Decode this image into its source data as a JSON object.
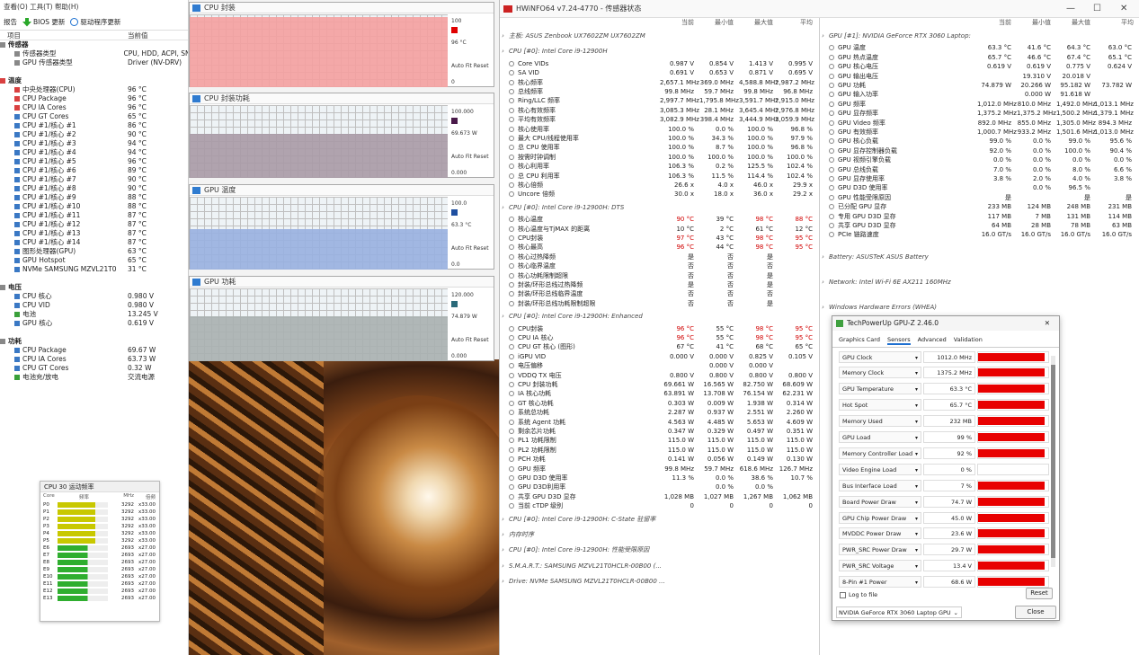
{
  "left": {
    "menu": "查看(O)    工具(T)    帮助(H)",
    "toolbar": {
      "report": "报告",
      "bios": "BIOS 更新",
      "driver": "驱动程序更新"
    },
    "col_item": "项目",
    "col_value": "当前值",
    "rows": [
      {
        "n": "传感器",
        "v": "",
        "cls": "sec",
        "ind": "",
        "icon": "v"
      },
      {
        "n": "传感器类型",
        "v": "CPU, HDD, ACPI, SN",
        "cls": "",
        "ind": "ind1",
        "icon": "v"
      },
      {
        "n": "GPU 传感器类型",
        "v": "Driver (NV-DRV)",
        "cls": "",
        "ind": "ind1",
        "icon": "v"
      },
      {
        "n": "",
        "v": "",
        "cls": "",
        "ind": "",
        "icon": ""
      },
      {
        "n": "温度",
        "v": "",
        "cls": "sec",
        "ind": "",
        "icon": "t"
      },
      {
        "n": "中央处理器(CPU)",
        "v": "96 °C",
        "cls": "",
        "ind": "ind1",
        "icon": "t"
      },
      {
        "n": "CPU Package",
        "v": "96 °C",
        "cls": "",
        "ind": "ind1",
        "icon": "t"
      },
      {
        "n": "CPU IA Cores",
        "v": "96 °C",
        "cls": "",
        "ind": "ind1",
        "icon": "t"
      },
      {
        "n": "CPU GT Cores",
        "v": "65 °C",
        "cls": "",
        "ind": "ind1",
        "icon": ""
      },
      {
        "n": "CPU #1/核心 #1",
        "v": "86 °C",
        "cls": "",
        "ind": "ind1",
        "icon": ""
      },
      {
        "n": "CPU #1/核心 #2",
        "v": "90 °C",
        "cls": "",
        "ind": "ind1",
        "icon": ""
      },
      {
        "n": "CPU #1/核心 #3",
        "v": "94 °C",
        "cls": "",
        "ind": "ind1",
        "icon": ""
      },
      {
        "n": "CPU #1/核心 #4",
        "v": "94 °C",
        "cls": "",
        "ind": "ind1",
        "icon": ""
      },
      {
        "n": "CPU #1/核心 #5",
        "v": "96 °C",
        "cls": "",
        "ind": "ind1",
        "icon": ""
      },
      {
        "n": "CPU #1/核心 #6",
        "v": "89 °C",
        "cls": "",
        "ind": "ind1",
        "icon": ""
      },
      {
        "n": "CPU #1/核心 #7",
        "v": "90 °C",
        "cls": "",
        "ind": "ind1",
        "icon": ""
      },
      {
        "n": "CPU #1/核心 #8",
        "v": "90 °C",
        "cls": "",
        "ind": "ind1",
        "icon": ""
      },
      {
        "n": "CPU #1/核心 #9",
        "v": "88 °C",
        "cls": "",
        "ind": "ind1",
        "icon": ""
      },
      {
        "n": "CPU #1/核心 #10",
        "v": "88 °C",
        "cls": "",
        "ind": "ind1",
        "icon": ""
      },
      {
        "n": "CPU #1/核心 #11",
        "v": "87 °C",
        "cls": "",
        "ind": "ind1",
        "icon": ""
      },
      {
        "n": "CPU #1/核心 #12",
        "v": "87 °C",
        "cls": "",
        "ind": "ind1",
        "icon": ""
      },
      {
        "n": "CPU #1/核心 #13",
        "v": "87 °C",
        "cls": "",
        "ind": "ind1",
        "icon": ""
      },
      {
        "n": "CPU #1/核心 #14",
        "v": "87 °C",
        "cls": "",
        "ind": "ind1",
        "icon": ""
      },
      {
        "n": "图形处理器(GPU)",
        "v": "63 °C",
        "cls": "",
        "ind": "ind1",
        "icon": ""
      },
      {
        "n": "GPU Hotspot",
        "v": "65 °C",
        "cls": "",
        "ind": "ind1",
        "icon": ""
      },
      {
        "n": "NVMe SAMSUNG MZVL21T0",
        "v": "31 °C",
        "cls": "",
        "ind": "ind1",
        "icon": ""
      },
      {
        "n": "",
        "v": "",
        "cls": "",
        "ind": "",
        "icon": ""
      },
      {
        "n": "电压",
        "v": "",
        "cls": "sec",
        "ind": "",
        "icon": "v"
      },
      {
        "n": "CPU 核心",
        "v": "0.980 V",
        "cls": "",
        "ind": "ind1",
        "icon": ""
      },
      {
        "n": "CPU VID",
        "v": "0.980 V",
        "cls": "",
        "ind": "ind1",
        "icon": ""
      },
      {
        "n": "电池",
        "v": "13.245 V",
        "cls": "",
        "ind": "ind1",
        "icon": "p"
      },
      {
        "n": "GPU 核心",
        "v": "0.619 V",
        "cls": "",
        "ind": "ind1",
        "icon": ""
      },
      {
        "n": "",
        "v": "",
        "cls": "",
        "ind": "",
        "icon": ""
      },
      {
        "n": "功耗",
        "v": "",
        "cls": "sec",
        "ind": "",
        "icon": "v"
      },
      {
        "n": "CPU Package",
        "v": "69.67 W",
        "cls": "",
        "ind": "ind1",
        "icon": ""
      },
      {
        "n": "CPU IA Cores",
        "v": "63.73 W",
        "cls": "",
        "ind": "ind1",
        "icon": ""
      },
      {
        "n": "CPU GT Cores",
        "v": "0.32 W",
        "cls": "",
        "ind": "ind1",
        "icon": ""
      },
      {
        "n": "电池充/放电",
        "v": "交流电源",
        "cls": "",
        "ind": "ind1",
        "icon": "p"
      }
    ]
  },
  "cpuz": {
    "title": "CPU 30  运动频率",
    "hdr": [
      "Core",
      "频率",
      "MHz",
      "倍频"
    ],
    "rows": [
      {
        "c": "P0",
        "mhz": "3292",
        "mul": "x33.00",
        "type": "p",
        "fill": 0.75
      },
      {
        "c": "P1",
        "mhz": "3292",
        "mul": "x33.00",
        "type": "p",
        "fill": 0.75
      },
      {
        "c": "P2",
        "mhz": "3292",
        "mul": "x33.00",
        "type": "p",
        "fill": 0.75
      },
      {
        "c": "P3",
        "mhz": "3292",
        "mul": "x33.00",
        "type": "p",
        "fill": 0.75
      },
      {
        "c": "P4",
        "mhz": "3292",
        "mul": "x33.00",
        "type": "p",
        "fill": 0.75
      },
      {
        "c": "P5",
        "mhz": "3292",
        "mul": "x33.00",
        "type": "p",
        "fill": 0.75
      },
      {
        "c": "E6",
        "mhz": "2693",
        "mul": "x27.00",
        "type": "e",
        "fill": 0.6
      },
      {
        "c": "E7",
        "mhz": "2693",
        "mul": "x27.00",
        "type": "e",
        "fill": 0.6
      },
      {
        "c": "E8",
        "mhz": "2693",
        "mul": "x27.00",
        "type": "e",
        "fill": 0.6
      },
      {
        "c": "E9",
        "mhz": "2693",
        "mul": "x27.00",
        "type": "e",
        "fill": 0.6
      },
      {
        "c": "E10",
        "mhz": "2693",
        "mul": "x27.00",
        "type": "e",
        "fill": 0.6
      },
      {
        "c": "E11",
        "mhz": "2693",
        "mul": "x27.00",
        "type": "e",
        "fill": 0.6
      },
      {
        "c": "E12",
        "mhz": "2693",
        "mul": "x27.00",
        "type": "e",
        "fill": 0.6
      },
      {
        "c": "E13",
        "mhz": "2693",
        "mul": "x27.00",
        "type": "e",
        "fill": 0.6
      }
    ]
  },
  "graphs": [
    {
      "title": "CPU 封装",
      "max": "100",
      "cur": "96 °C",
      "min": "0",
      "btn": "Auto Fit  Reset",
      "color": "#f4a0a0",
      "fill": 0.96,
      "sw": "#e00000"
    },
    {
      "title": "CPU 封装功耗",
      "max": "100.000",
      "cur": "69.673 W",
      "min": "0.000",
      "btn": "Auto Fit  Reset",
      "color": "#a89aa6",
      "fill": 0.6,
      "sw": "#4a1a4a"
    },
    {
      "title": "GPU 温度",
      "max": "100.0",
      "cur": "63.3 °C",
      "min": "0.0",
      "btn": "Auto Fit  Reset",
      "color": "#98b0e0",
      "fill": 0.55,
      "sw": "#1e4fa0"
    },
    {
      "title": "GPU 功耗",
      "max": "120.000",
      "cur": "74.879 W",
      "min": "0.000",
      "btn": "Auto Fit  Reset",
      "color": "#a8b0b0",
      "fill": 0.62,
      "sw": "#2a6a7a"
    }
  ],
  "hwinfo": {
    "title": "HWiNFO64 v7.24-4770 - 传感器状态",
    "cols": [
      "当前",
      "最小值",
      "最大值",
      "平均"
    ],
    "left_rows": [
      {
        "g": 1,
        "n": "主板: ASUS Zenbook UX7602ZM UX7602ZM"
      },
      {
        "g": 1,
        "n": "CPU [#0]: Intel Core i9-12900H"
      },
      {
        "n": "Core VIDs",
        "a": "0.987 V",
        "b": "0.854 V",
        "c": "1.413 V",
        "d": "0.995 V"
      },
      {
        "n": "SA VID",
        "a": "0.691 V",
        "b": "0.653 V",
        "c": "0.871 V",
        "d": "0.695 V"
      },
      {
        "n": "核心频率",
        "a": "2,657.1 MHz",
        "b": "369.0 MHz",
        "c": "4,588.8 MHz",
        "d": "2,987.2 MHz"
      },
      {
        "n": "总线频率",
        "a": "99.8 MHz",
        "b": "59.7 MHz",
        "c": "99.8 MHz",
        "d": "96.8 MHz"
      },
      {
        "n": "Ring/LLC 频率",
        "a": "2,997.7 MHz",
        "b": "1,795.8 MHz",
        "c": "3,591.7 MHz",
        "d": "2,915.0 MHz"
      },
      {
        "n": "核心有效频率",
        "a": "3,085.3 MHz",
        "b": "28.1 MHz",
        "c": "3,645.4 MHz",
        "d": "2,976.8 MHz"
      },
      {
        "n": "平均有效频率",
        "a": "3,082.9 MHz",
        "b": "398.4 MHz",
        "c": "3,444.9 MHz",
        "d": "3,059.9 MHz"
      },
      {
        "n": "核心使用率",
        "a": "100.0 %",
        "b": "0.0 %",
        "c": "100.0 %",
        "d": "96.8 %"
      },
      {
        "n": "最大 CPU/线程使用率",
        "a": "100.0 %",
        "b": "34.3 %",
        "c": "100.0 %",
        "d": "97.9 %"
      },
      {
        "n": "总 CPU 使用率",
        "a": "100.0 %",
        "b": "8.7 %",
        "c": "100.0 %",
        "d": "96.8 %"
      },
      {
        "n": "按需时钟调制",
        "a": "100.0 %",
        "b": "100.0 %",
        "c": "100.0 %",
        "d": "100.0 %"
      },
      {
        "n": "核心利用率",
        "a": "106.3 %",
        "b": "0.2 %",
        "c": "125.5 %",
        "d": "102.4 %"
      },
      {
        "n": "总 CPU 利用率",
        "a": "106.3 %",
        "b": "11.5 %",
        "c": "114.4 %",
        "d": "102.4 %"
      },
      {
        "n": "核心倍频",
        "a": "26.6 x",
        "b": "4.0 x",
        "c": "46.0 x",
        "d": "29.9 x"
      },
      {
        "n": "Uncore 倍频",
        "a": "30.0 x",
        "b": "18.0 x",
        "c": "36.0 x",
        "d": "29.2 x"
      },
      {
        "g": 1,
        "n": "CPU [#0]: Intel Core i9-12900H: DTS"
      },
      {
        "n": "核心温度",
        "a": "90 °C",
        "b": "39 °C",
        "c": "98 °C",
        "d": "88 °C",
        "red": 1
      },
      {
        "n": "核心温度与TjMAX 的距离",
        "a": "10 °C",
        "b": "2 °C",
        "c": "61 °C",
        "d": "12 °C"
      },
      {
        "n": "CPU封装",
        "a": "97 °C",
        "b": "43 °C",
        "c": "98 °C",
        "d": "95 °C",
        "red": 1
      },
      {
        "n": "核心最高",
        "a": "96 °C",
        "b": "44 °C",
        "c": "98 °C",
        "d": "95 °C",
        "red": 1
      },
      {
        "n": "核心过热降频",
        "a": "是",
        "b": "否",
        "c": "是",
        "d": ""
      },
      {
        "n": "核心临界温度",
        "a": "否",
        "b": "否",
        "c": "否",
        "d": ""
      },
      {
        "n": "核心功耗限制超限",
        "a": "否",
        "b": "否",
        "c": "是",
        "d": ""
      },
      {
        "n": "封装/环形总线过热降频",
        "a": "是",
        "b": "否",
        "c": "是",
        "d": ""
      },
      {
        "n": "封装/环形总线临界温度",
        "a": "否",
        "b": "否",
        "c": "否",
        "d": ""
      },
      {
        "n": "封装/环形总线功耗限制超限",
        "a": "否",
        "b": "否",
        "c": "是",
        "d": ""
      },
      {
        "g": 1,
        "n": "CPU [#0]: Intel Core i9-12900H: Enhanced"
      },
      {
        "n": "CPU封装",
        "a": "96 °C",
        "b": "55 °C",
        "c": "98 °C",
        "d": "95 °C",
        "red": 1
      },
      {
        "n": "CPU IA 核心",
        "a": "96 °C",
        "b": "55 °C",
        "c": "98 °C",
        "d": "95 °C",
        "red": 1
      },
      {
        "n": "CPU GT 核心 (图形)",
        "a": "67 °C",
        "b": "41 °C",
        "c": "68 °C",
        "d": "65 °C"
      },
      {
        "n": "iGPU VID",
        "a": "0.000 V",
        "b": "0.000 V",
        "c": "0.825 V",
        "d": "0.105 V"
      },
      {
        "n": "电压偏移",
        "a": "",
        "b": "0.000 V",
        "c": "0.000 V",
        "d": ""
      },
      {
        "n": "VDDQ TX 电压",
        "a": "0.800 V",
        "b": "0.800 V",
        "c": "0.800 V",
        "d": "0.800 V"
      },
      {
        "n": "CPU 封装功耗",
        "a": "69.661 W",
        "b": "16.565 W",
        "c": "82.750 W",
        "d": "68.609 W"
      },
      {
        "n": "IA 核心功耗",
        "a": "63.891 W",
        "b": "13.708 W",
        "c": "76.154 W",
        "d": "62.231 W"
      },
      {
        "n": "GT 核心功耗",
        "a": "0.303 W",
        "b": "0.009 W",
        "c": "1.938 W",
        "d": "0.314 W"
      },
      {
        "n": "系统总功耗",
        "a": "2.287 W",
        "b": "0.937 W",
        "c": "2.551 W",
        "d": "2.260 W"
      },
      {
        "n": "系统 Agent 功耗",
        "a": "4.563 W",
        "b": "4.485 W",
        "c": "5.653 W",
        "d": "4.609 W"
      },
      {
        "n": "剩余芯片功耗",
        "a": "0.347 W",
        "b": "0.329 W",
        "c": "0.497 W",
        "d": "0.351 W"
      },
      {
        "n": "PL1 功耗限制",
        "a": "115.0 W",
        "b": "115.0 W",
        "c": "115.0 W",
        "d": "115.0 W"
      },
      {
        "n": "PL2 功耗限制",
        "a": "115.0 W",
        "b": "115.0 W",
        "c": "115.0 W",
        "d": "115.0 W"
      },
      {
        "n": "PCH 功耗",
        "a": "0.141 W",
        "b": "0.056 W",
        "c": "0.149 W",
        "d": "0.130 W"
      },
      {
        "n": "GPU 频率",
        "a": "99.8 MHz",
        "b": "59.7 MHz",
        "c": "618.6 MHz",
        "d": "126.7 MHz"
      },
      {
        "n": "GPU D3D 使用率",
        "a": "11.3 %",
        "b": "0.0 %",
        "c": "38.6 %",
        "d": "10.7 %"
      },
      {
        "n": "GPU D3D利用率",
        "a": "",
        "b": "0.0 %",
        "c": "0.0 %",
        "d": ""
      },
      {
        "n": "共享 GPU D3D 显存",
        "a": "1,028 MB",
        "b": "1,027 MB",
        "c": "1,267 MB",
        "d": "1,062 MB"
      },
      {
        "n": "当前 cTDP 级别",
        "a": "0",
        "b": "0",
        "c": "0",
        "d": "0"
      },
      {
        "g": 1,
        "n": "CPU [#0]: Intel Core i9-12900H: C-State 驻留率"
      },
      {
        "g": 1,
        "n": "内存时序"
      },
      {
        "g": 1,
        "n": "CPU [#0]: Intel Core i9-12900H: 性能受限原因"
      },
      {
        "g": 1,
        "n": "S.M.A.R.T.: SAMSUNG MZVL21T0HCLR-00B00 (..."
      },
      {
        "g": 1,
        "n": "Drive: NVMe SAMSUNG MZVL21T0HCLR-00B00 ..."
      }
    ],
    "right_rows": [
      {
        "g": 1,
        "n": "GPU [#1]: NVIDIA GeForce RTX 3060 Laptop:"
      },
      {
        "n": "GPU 温度",
        "a": "63.3 °C",
        "b": "41.6 °C",
        "c": "64.3 °C",
        "d": "63.0 °C"
      },
      {
        "n": "GPU 热点温度",
        "a": "65.7 °C",
        "b": "46.6 °C",
        "c": "67.4 °C",
        "d": "65.1 °C"
      },
      {
        "n": "GPU 核心电压",
        "a": "0.619 V",
        "b": "0.619 V",
        "c": "0.775 V",
        "d": "0.624 V"
      },
      {
        "n": "GPU 输出电压",
        "a": "",
        "b": "19.310 V",
        "c": "20.018 V",
        "d": ""
      },
      {
        "n": "GPU 功耗",
        "a": "74.879 W",
        "b": "20.266 W",
        "c": "95.182 W",
        "d": "73.782 W"
      },
      {
        "n": "GPU 输入功率",
        "a": "",
        "b": "0.000 W",
        "c": "91.618 W",
        "d": ""
      },
      {
        "n": "GPU 频率",
        "a": "1,012.0 MHz",
        "b": "810.0 MHz",
        "c": "1,492.0 MHz",
        "d": "1,013.1 MHz"
      },
      {
        "n": "GPU 显存频率",
        "a": "1,375.2 MHz",
        "b": "1,375.2 MHz",
        "c": "1,500.2 MHz",
        "d": "1,379.1 MHz"
      },
      {
        "n": "GPU Video 频率",
        "a": "892.0 MHz",
        "b": "855.0 MHz",
        "c": "1,305.0 MHz",
        "d": "894.3 MHz"
      },
      {
        "n": "GPU 有效频率",
        "a": "1,000.7 MHz",
        "b": "933.2 MHz",
        "c": "1,501.6 MHz",
        "d": "1,013.0 MHz"
      },
      {
        "n": "GPU 核心负载",
        "a": "99.0 %",
        "b": "0.0 %",
        "c": "99.0 %",
        "d": "95.6 %"
      },
      {
        "n": "GPU 显存控制器负载",
        "a": "92.0 %",
        "b": "0.0 %",
        "c": "100.0 %",
        "d": "90.4 %"
      },
      {
        "n": "GPU 视频引擎负载",
        "a": "0.0 %",
        "b": "0.0 %",
        "c": "0.0 %",
        "d": "0.0 %"
      },
      {
        "n": "GPU 总线负载",
        "a": "7.0 %",
        "b": "0.0 %",
        "c": "8.0 %",
        "d": "6.6 %"
      },
      {
        "n": "GPU 显存使用率",
        "a": "3.8 %",
        "b": "2.0 %",
        "c": "4.0 %",
        "d": "3.8 %"
      },
      {
        "n": "GPU D3D 使用率",
        "a": "",
        "b": "0.0 %",
        "c": "96.5 %",
        "d": ""
      },
      {
        "n": "GPU 性能受限原因",
        "a": "是",
        "b": "",
        "c": "是",
        "d": "是"
      },
      {
        "n": "已分配 GPU 显存",
        "a": "233 MB",
        "b": "124 MB",
        "c": "248 MB",
        "d": "231 MB"
      },
      {
        "n": "专用 GPU D3D 显存",
        "a": "117 MB",
        "b": "7 MB",
        "c": "131 MB",
        "d": "114 MB"
      },
      {
        "n": "共享 GPU D3D 显存",
        "a": "64 MB",
        "b": "28 MB",
        "c": "78 MB",
        "d": "63 MB"
      },
      {
        "n": "PCIe 链路速度",
        "a": "16.0 GT/s",
        "b": "16.0 GT/s",
        "c": "16.0 GT/s",
        "d": "16.0 GT/s"
      },
      {
        "sp": 1
      },
      {
        "g": 1,
        "n": "Battery: ASUSTeK ASUS Battery"
      },
      {
        "sp": 1
      },
      {
        "g": 1,
        "n": "Network: Intel Wi-Fi 6E AX211 160MHz"
      },
      {
        "sp": 1
      },
      {
        "g": 1,
        "n": "Windows Hardware Errors (WHEA)"
      }
    ]
  },
  "gpuz": {
    "title": "TechPowerUp GPU-Z 2.46.0",
    "tabs": [
      "Graphics Card",
      "Sensors",
      "Advanced",
      "Validation"
    ],
    "rows": [
      {
        "l": "GPU Clock",
        "v": "1012.0 MHz",
        "f": 0.95
      },
      {
        "l": "Memory Clock",
        "v": "1375.2 MHz",
        "f": 0.95
      },
      {
        "l": "GPU Temperature",
        "v": "63.3 °C",
        "f": 0.95
      },
      {
        "l": "Hot Spot",
        "v": "65.7 °C",
        "f": 0.95
      },
      {
        "l": "Memory Used",
        "v": "232 MB",
        "f": 0.95
      },
      {
        "l": "GPU Load",
        "v": "99 %",
        "f": 0.95
      },
      {
        "l": "Memory Controller Load",
        "v": "92 %",
        "f": 0.95
      },
      {
        "l": "Video Engine Load",
        "v": "0 %",
        "f": 0
      },
      {
        "l": "Bus Interface Load",
        "v": "7 %",
        "f": 0.95
      },
      {
        "l": "Board Power Draw",
        "v": "74.7 W",
        "f": 0.95
      },
      {
        "l": "GPU Chip Power Draw",
        "v": "45.0 W",
        "f": 0.95
      },
      {
        "l": "MVDDC Power Draw",
        "v": "23.6 W",
        "f": 0.95
      },
      {
        "l": "PWR_SRC Power Draw",
        "v": "29.7 W",
        "f": 0.95
      },
      {
        "l": "PWR_SRC Voltage",
        "v": "13.4 V",
        "f": 0.95
      },
      {
        "l": "8-Pin #1 Power",
        "v": "68.6 W",
        "f": 0.95
      }
    ],
    "log": "Log to file",
    "reset": "Reset",
    "device": "NVIDIA GeForce RTX 3060 Laptop GPU",
    "close": "Close"
  }
}
